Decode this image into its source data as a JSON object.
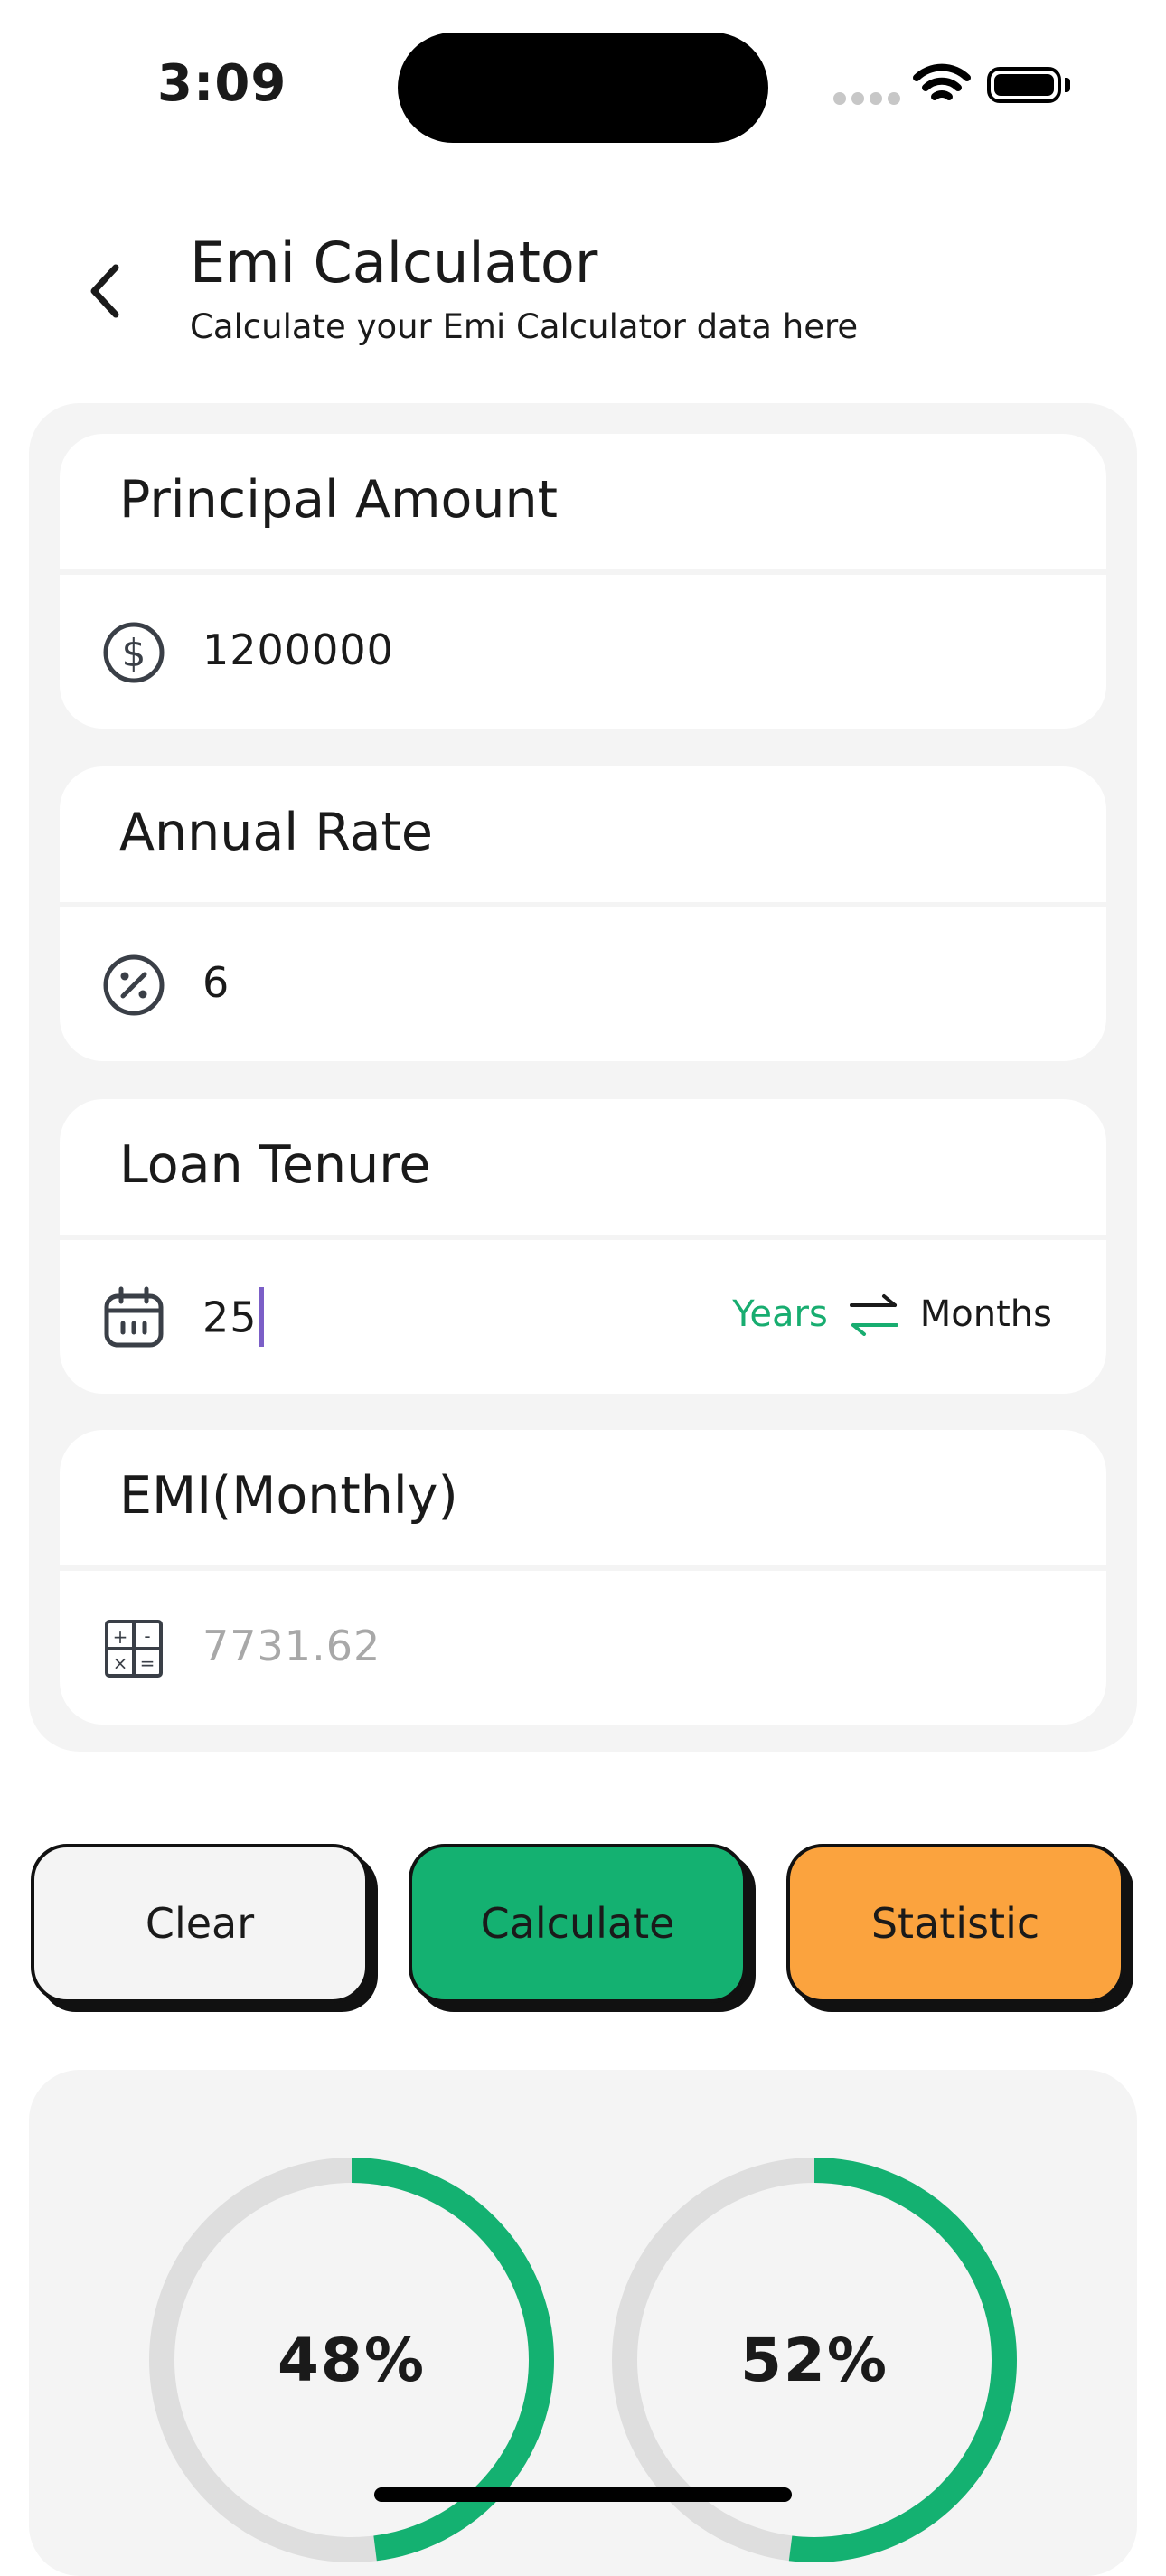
{
  "status_bar": {
    "time": "3:09"
  },
  "header": {
    "title": "Emi Calculator",
    "subtitle": "Calculate your Emi Calculator data here",
    "back_icon": "chevron-left-icon"
  },
  "form": {
    "principal": {
      "label": "Principal Amount",
      "value": "1200000",
      "icon": "dollar-circle-icon"
    },
    "rate": {
      "label": "Annual Rate",
      "value": "6",
      "icon": "percent-circle-icon"
    },
    "tenure": {
      "label": "Loan Tenure",
      "value": "25",
      "icon": "calendar-icon",
      "unit_selected": "Years",
      "unit_other": "Months",
      "swap_icon": "swap-arrows-icon"
    },
    "emi": {
      "label": "EMI(Monthly)",
      "value": "7731.62",
      "icon": "calculator-icon"
    }
  },
  "actions": {
    "clear": "Clear",
    "calculate": "Calculate",
    "statistic": "Statistic"
  },
  "stats": {
    "left_ring": {
      "label": "48%",
      "fraction": 0.48
    },
    "right_ring": {
      "label": "52%",
      "fraction": 0.52
    }
  },
  "colors": {
    "accent_green": "#14b171",
    "accent_orange": "#fba33e",
    "ring_track": "#dedede",
    "caret": "#7b5fc7"
  }
}
